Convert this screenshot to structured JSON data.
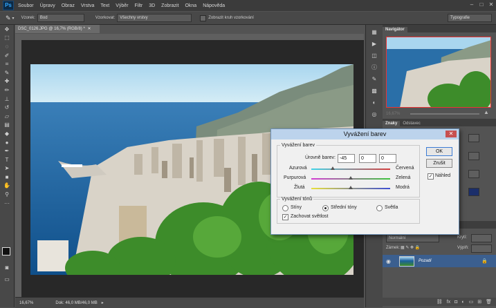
{
  "menu": {
    "app_logo": "Ps",
    "items": [
      "Soubor",
      "Úpravy",
      "Obraz",
      "Vrstva",
      "Text",
      "Výběr",
      "Filtr",
      "3D",
      "Zobrazit",
      "Okna",
      "Nápověda"
    ]
  },
  "options_bar": {
    "sample_label": "Vzorek:",
    "sample_value": "Bod",
    "sampling_label": "Vzorkovat:",
    "sampling_value": "Všechny vrstvy",
    "ring_label": "Zobrazit kruh vzorkování",
    "workspace": "Typografie"
  },
  "document": {
    "tab_label": "DSC_0126.JPG @ 16,7% (RGB/8) *",
    "zoom": "16,67%",
    "doc_info": "Dok: 46,0 MB/46,0 MB"
  },
  "navigator": {
    "tab": "Navigátor",
    "zoom": "16,67%"
  },
  "colors_panel": {
    "tab_active": "Znaky",
    "tab_other": "Odstavec"
  },
  "layers": {
    "blend_mode": "Normální",
    "opacity_label": "Krytí:",
    "lock_label": "Zámek:",
    "fill_label": "Výplň:",
    "layer_name": "Pozadí"
  },
  "dialog": {
    "title": "Vyvážení barev",
    "group_balance": "Vyvážení barev",
    "levels_label": "Úrovně barev:",
    "level1": "-45",
    "level2": "0",
    "level3": "0",
    "sliders": [
      {
        "left": "Azurová",
        "right": "Červená",
        "value": -45
      },
      {
        "left": "Purpurová",
        "right": "Zelená",
        "value": 0
      },
      {
        "left": "Žlutá",
        "right": "Modrá",
        "value": 0
      }
    ],
    "group_tones": "Vyvážení tónů",
    "tone_shadows": "Stíny",
    "tone_midtones": "Střední tóny",
    "tone_highlights": "Světla",
    "preserve_label": "Zachovat světlost",
    "ok": "OK",
    "cancel": "Zrušit",
    "preview": "Náhled"
  },
  "colors": {
    "accent": "#31a8ff",
    "sky": "#9fd0ec",
    "sea": "#1a5f9c",
    "dialog_bg": "#f0f0f0",
    "close_red": "#c75050"
  }
}
